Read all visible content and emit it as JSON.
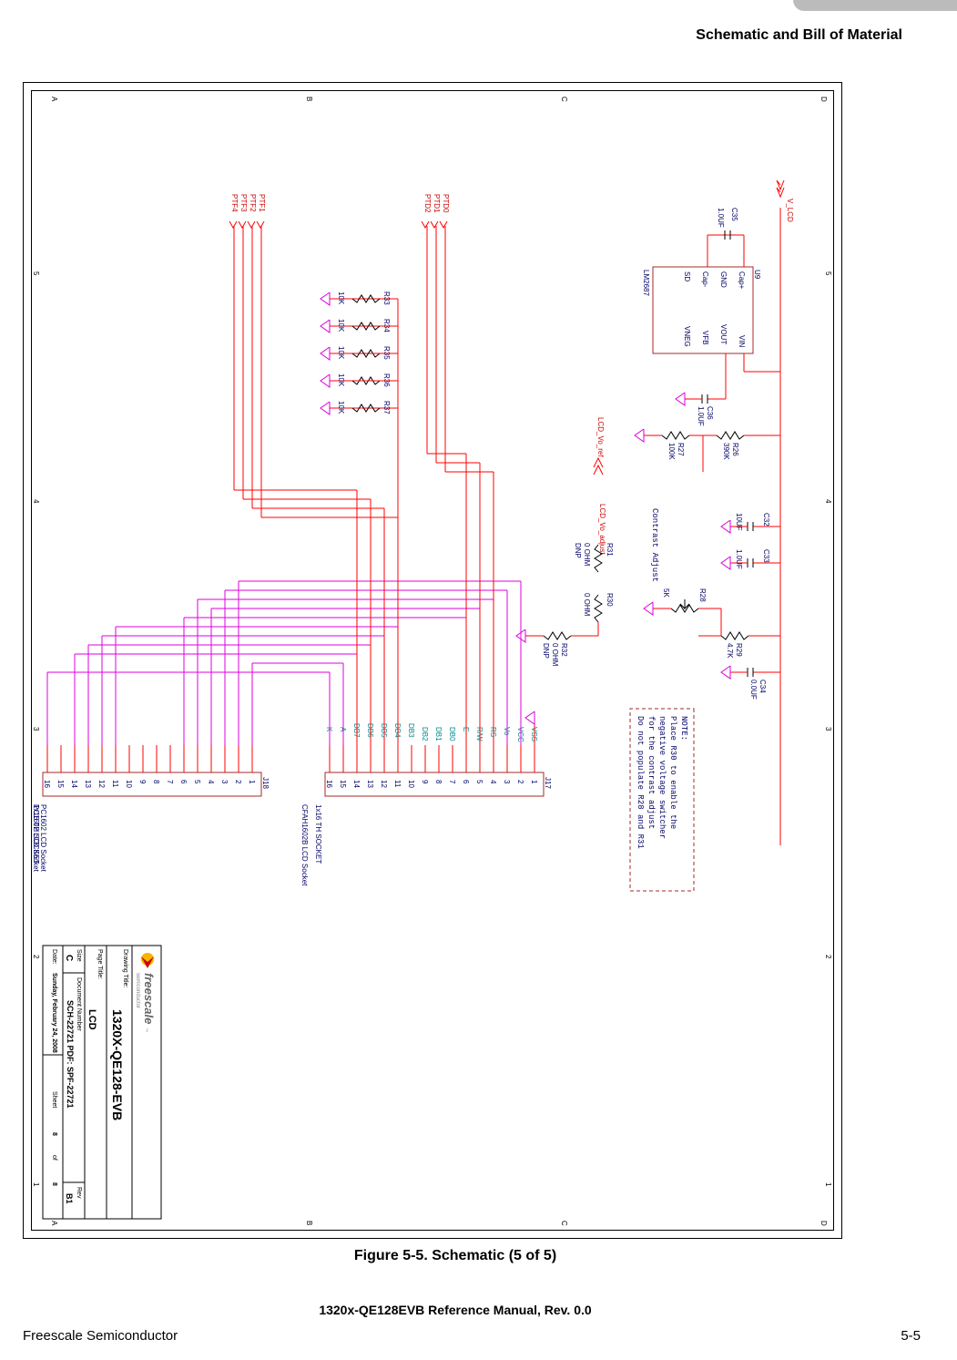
{
  "page": {
    "header": "Schematic and Bill of Material",
    "figure_caption": "Figure 5-5. Schematic (5 of 5)",
    "doc_title": "1320x-QE128EVB Reference Manual, Rev. 0.0",
    "footer_left": "Freescale Semiconductor",
    "footer_right": "5-5"
  },
  "schematic": {
    "top_signal": "V_LCD",
    "ic": {
      "ref": "U9",
      "part": "LM2687",
      "pins": {
        "1": "Cap+",
        "2": "GND",
        "3": "Cap-",
        "4": "SD",
        "5": "VNEG",
        "6": "VFB",
        "7": "VOUT",
        "8": "VIN"
      }
    },
    "caps": [
      {
        "ref": "C35",
        "val": "1.0UF"
      },
      {
        "ref": "C36",
        "val": "1.0UF"
      },
      {
        "ref": "C32",
        "val": "10UF"
      },
      {
        "ref": "C33",
        "val": "1.0UF"
      },
      {
        "ref": "C34",
        "val": "0.0UF"
      }
    ],
    "resistors": [
      {
        "ref": "R26",
        "val": "390K"
      },
      {
        "ref": "R27",
        "val": "100K"
      },
      {
        "ref": "R28",
        "val": "5K"
      },
      {
        "ref": "R29",
        "val": "4.7K"
      },
      {
        "ref": "R30",
        "val": "0 OHM",
        "note": ""
      },
      {
        "ref": "R31",
        "val": "0 OHM",
        "note": "DNP"
      },
      {
        "ref": "R32",
        "val": "0 OHM",
        "note": "DNP"
      },
      {
        "ref": "R33",
        "val": "10K"
      },
      {
        "ref": "R34",
        "val": "10K"
      },
      {
        "ref": "R35",
        "val": "10K"
      },
      {
        "ref": "R36",
        "val": "10K"
      },
      {
        "ref": "R37",
        "val": "10K"
      }
    ],
    "contrast_label": "Contrast Adjust",
    "note_box": [
      "NOTE:",
      "Place R30 to enable the",
      "negative voltage switcher",
      "for the contrast adjust",
      "Do not populate R28 and R31"
    ],
    "lcd_signals_ref": [
      "LCD_Vo_ref",
      "LCD_Vo_adjust"
    ],
    "port_signals_left": [
      "PTD0",
      "PTD1",
      "PTD2"
    ],
    "port_signals_right": [
      "PTF1",
      "PTF2",
      "PTF3",
      "PTF4"
    ],
    "j17": {
      "ref": "J17",
      "type": "1x16 TH SOCKET",
      "desc": "CFAH1602B LCD Socket",
      "pins": {
        "1": "VSS",
        "2": "VCC",
        "3": "Vo",
        "4": "RS",
        "5": "R/W",
        "6": "E",
        "7": "DB0",
        "8": "DB1",
        "9": "DB2",
        "10": "DB3",
        "11": "DB4",
        "12": "DB5",
        "13": "DB6",
        "14": "DB7",
        "15": "A",
        "16": "K"
      }
    },
    "j18": {
      "ref": "J18",
      "type": "1x16 TH SOCKET",
      "desc": "PC1602 LCD Socket"
    },
    "titleblock": {
      "logo_text": "freescale",
      "logo_tag": "semiconductor",
      "drawing_title_label": "Drawing Title:",
      "drawing_title": "1320X-QE128-EVB",
      "page_title_label": "Page Title:",
      "page_title": "LCD",
      "size_label": "Size",
      "size": "C",
      "docnum_label": "Document Number",
      "docnum": "SCH-22721 PDF: SPF-22721",
      "rev_label": "Rev",
      "rev": "B1",
      "date_label": "Date:",
      "date": "Sunday, February 24, 2008",
      "sheet_label": "Sheet",
      "sheet": "8",
      "of_label": "of",
      "of": "8"
    }
  }
}
